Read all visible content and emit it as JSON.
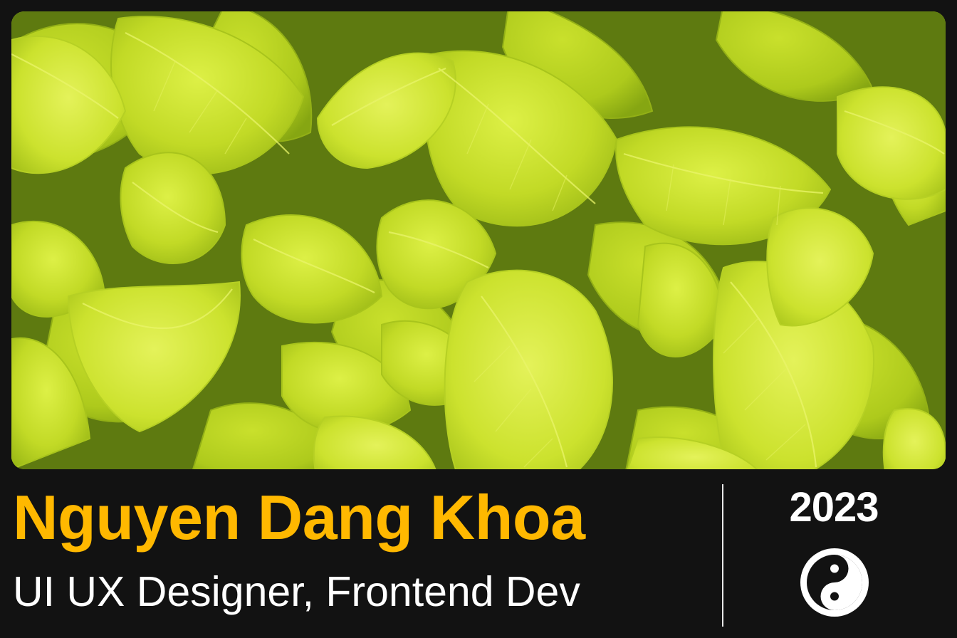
{
  "profile": {
    "name": "Nguyen Dang Khoa",
    "role": "UI UX Designer, Frontend Dev",
    "year": "2023"
  },
  "icons": {
    "symbol": "yin-yang-icon"
  },
  "colors": {
    "background": "#121212",
    "name": "#FFB800",
    "text": "#FFFFFF",
    "leaf_light": "#D4EC38",
    "leaf_mid": "#B8D21E",
    "leaf_shadow": "#6E8A12"
  }
}
